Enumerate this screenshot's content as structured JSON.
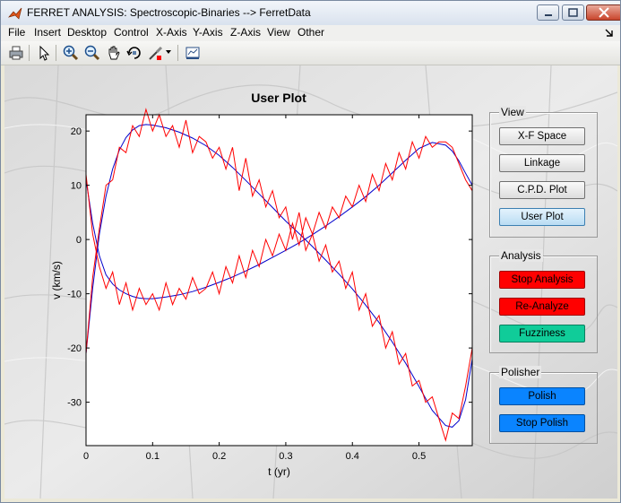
{
  "window": {
    "title": "FERRET ANALYSIS: Spectroscopic-Binaries --> FerretData",
    "controls": [
      "minimize-icon",
      "maximize-icon",
      "close-icon"
    ]
  },
  "menu": {
    "items": [
      "File",
      "Insert",
      "Desktop",
      "Control",
      "X-Axis",
      "Y-Axis",
      "Z-Axis",
      "View",
      "Other"
    ]
  },
  "toolbar": {
    "tools": [
      "print-icon",
      "pointer-icon",
      "zoom-in-icon",
      "zoom-out-icon",
      "pan-icon",
      "rotate-icon",
      "brush-icon",
      "dropdown-arrow-icon",
      "data-cursor-icon"
    ]
  },
  "plot": {
    "title": "User Plot",
    "xlabel": "t (yr)",
    "ylabel": "v (km/s)"
  },
  "chart_data": {
    "type": "line",
    "title": "User Plot",
    "xlabel": "t (yr)",
    "ylabel": "v (km/s)",
    "xlim": [
      0,
      0.58
    ],
    "ylim": [
      -38,
      23
    ],
    "xticks": [
      0,
      0.1,
      0.2,
      0.3,
      0.4,
      0.5
    ],
    "yticks": [
      20,
      10,
      0,
      -10,
      -20,
      -30
    ],
    "series": [
      {
        "color": "#0000cc",
        "x": [
          0,
          0.01,
          0.02,
          0.03,
          0.04,
          0.05,
          0.06,
          0.07,
          0.08,
          0.09,
          0.1,
          0.12,
          0.14,
          0.16,
          0.18,
          0.2,
          0.22,
          0.24,
          0.26,
          0.28,
          0.3,
          0.32,
          0.34,
          0.36,
          0.38,
          0.4,
          0.42,
          0.44,
          0.46,
          0.48,
          0.5,
          0.52,
          0.54,
          0.55,
          0.56,
          0.57,
          0.58
        ],
        "y": [
          -21,
          -9,
          1,
          8,
          13,
          16.5,
          18.8,
          20.2,
          21,
          21.2,
          21.1,
          20.6,
          19.8,
          18.7,
          17.3,
          15.5,
          13.3,
          10.9,
          8.4,
          5.9,
          3.4,
          1.1,
          -1.3,
          -3.8,
          -6.4,
          -9.1,
          -12.1,
          -15.3,
          -18.9,
          -22.8,
          -27.1,
          -31.5,
          -34.3,
          -34.6,
          -33.4,
          -29.5,
          -22
        ]
      },
      {
        "color": "#0000cc",
        "x": [
          0,
          0.01,
          0.02,
          0.03,
          0.04,
          0.05,
          0.06,
          0.07,
          0.08,
          0.09,
          0.1,
          0.12,
          0.14,
          0.16,
          0.18,
          0.2,
          0.22,
          0.24,
          0.26,
          0.28,
          0.3,
          0.32,
          0.34,
          0.36,
          0.38,
          0.4,
          0.42,
          0.44,
          0.46,
          0.48,
          0.5,
          0.52,
          0.54,
          0.55,
          0.56,
          0.57,
          0.58
        ],
        "y": [
          11,
          3,
          -3,
          -6.5,
          -8.2,
          -9.3,
          -10,
          -10.5,
          -10.8,
          -10.9,
          -10.9,
          -10.6,
          -10.2,
          -9.6,
          -8.8,
          -7.9,
          -6.9,
          -5.8,
          -4.6,
          -3.3,
          -2,
          -0.6,
          0.9,
          2.5,
          4.2,
          6,
          7.9,
          10,
          12.3,
          14.6,
          16.8,
          17.9,
          17.4,
          16.3,
          14.5,
          12.2,
          10
        ]
      },
      {
        "color": "#ff0000",
        "x": [
          0,
          0.01,
          0.02,
          0.03,
          0.04,
          0.05,
          0.06,
          0.07,
          0.08,
          0.09,
          0.1,
          0.11,
          0.12,
          0.13,
          0.14,
          0.15,
          0.16,
          0.17,
          0.18,
          0.19,
          0.2,
          0.21,
          0.22,
          0.23,
          0.24,
          0.25,
          0.26,
          0.27,
          0.28,
          0.29,
          0.3,
          0.31,
          0.32,
          0.33,
          0.34,
          0.35,
          0.36,
          0.37,
          0.38,
          0.39,
          0.4,
          0.41,
          0.42,
          0.43,
          0.44,
          0.45,
          0.46,
          0.47,
          0.48,
          0.49,
          0.5,
          0.51,
          0.52,
          0.53,
          0.54,
          0.55,
          0.56,
          0.57,
          0.58
        ],
        "y": [
          -21,
          -7,
          2,
          10,
          11,
          17,
          16,
          21,
          19,
          24,
          20,
          23,
          19,
          21,
          17,
          22,
          16,
          19,
          18,
          15,
          17,
          13,
          17,
          9,
          15,
          8,
          11,
          6,
          9,
          4,
          6,
          0,
          5,
          -2,
          1,
          -4,
          -1,
          -6,
          -4,
          -9,
          -6,
          -13,
          -10,
          -16,
          -14,
          -20,
          -17,
          -23,
          -21,
          -27,
          -26,
          -30,
          -29,
          -33,
          -37,
          -32,
          -33,
          -27,
          -20
        ]
      },
      {
        "color": "#ff0000",
        "x": [
          0,
          0.01,
          0.02,
          0.03,
          0.04,
          0.05,
          0.06,
          0.07,
          0.08,
          0.09,
          0.1,
          0.11,
          0.12,
          0.13,
          0.14,
          0.15,
          0.16,
          0.17,
          0.18,
          0.19,
          0.2,
          0.21,
          0.22,
          0.23,
          0.24,
          0.25,
          0.26,
          0.27,
          0.28,
          0.29,
          0.3,
          0.31,
          0.32,
          0.33,
          0.34,
          0.35,
          0.36,
          0.37,
          0.38,
          0.39,
          0.4,
          0.41,
          0.42,
          0.43,
          0.44,
          0.45,
          0.46,
          0.47,
          0.48,
          0.49,
          0.5,
          0.51,
          0.52,
          0.53,
          0.54,
          0.55,
          0.56,
          0.57,
          0.58
        ],
        "y": [
          12,
          1,
          -5,
          -9,
          -6,
          -12,
          -8,
          -13,
          -9,
          -12,
          -10,
          -13,
          -8,
          -12,
          -9,
          -11,
          -7,
          -10,
          -9,
          -6,
          -10,
          -5,
          -8,
          -3,
          -7,
          -2,
          -5,
          0,
          -3,
          1,
          -2,
          3,
          -1,
          4,
          1,
          5,
          2,
          6,
          4,
          8,
          6,
          10,
          7,
          12,
          9,
          14,
          11,
          16,
          13,
          18,
          15,
          19,
          17,
          18,
          18,
          17,
          14,
          11,
          9
        ]
      }
    ]
  },
  "panels": {
    "view": {
      "label": "View",
      "buttons": [
        "X-F Space",
        "Linkage",
        "C.P.D. Plot",
        "User Plot"
      ]
    },
    "analysis": {
      "label": "Analysis",
      "buttons": [
        "Stop Analysis",
        "Re-Analyze",
        "Fuzziness"
      ]
    },
    "polisher": {
      "label": "Polisher",
      "buttons": [
        "Polish",
        "Stop Polish"
      ]
    }
  },
  "colors": {
    "red_button": "#ff0000",
    "teal_button": "#10cc99",
    "blue_button": "#0a84ff",
    "data_line": "#ff0000",
    "fit_line": "#0000cc"
  }
}
